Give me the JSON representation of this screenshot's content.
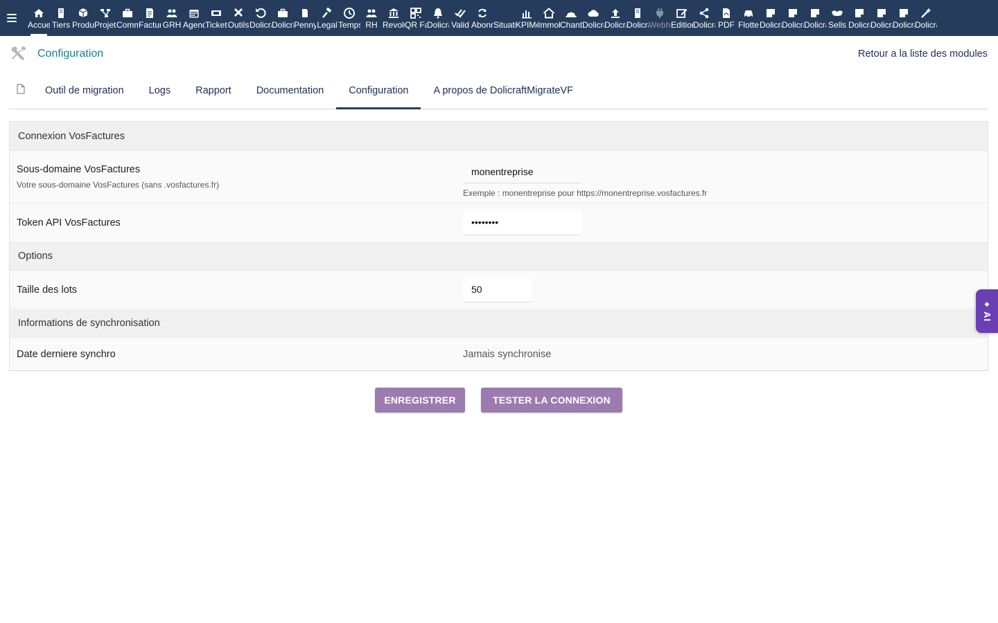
{
  "topbar": {
    "menu_items": [
      {
        "label": "Accueil",
        "icon": "home-icon"
      },
      {
        "label": "Tiers",
        "icon": "building-icon"
      },
      {
        "label": "Produits",
        "icon": "cube-icon"
      },
      {
        "label": "Projets",
        "icon": "sitemap-icon"
      },
      {
        "label": "Commerce",
        "icon": "briefcase-icon"
      },
      {
        "label": "Facturation",
        "icon": "invoice-icon"
      },
      {
        "label": "GRH",
        "icon": "users-icon"
      },
      {
        "label": "Agenda",
        "icon": "calendar-icon"
      },
      {
        "label": "Tickets",
        "icon": "ticket-icon"
      },
      {
        "label": "Outils",
        "icon": "tools-icon"
      },
      {
        "label": "Dolicraft",
        "icon": "undo-icon"
      },
      {
        "label": "Dolicraft",
        "icon": "briefcase-icon"
      },
      {
        "label": "Penny",
        "icon": "file-icon"
      },
      {
        "label": "Legal",
        "icon": "gavel-icon"
      },
      {
        "label": "Temps",
        "icon": "clock-icon"
      },
      {
        "label": "RH",
        "icon": "users-icon"
      },
      {
        "label": "Revolut",
        "icon": "bank-icon"
      },
      {
        "label": "QR Factures",
        "icon": "qrcode-icon"
      },
      {
        "label": "Dolicraft",
        "icon": "bell-icon"
      },
      {
        "label": "Valid",
        "icon": "check-double-icon"
      },
      {
        "label": "Abonnements",
        "icon": "refresh-icon"
      },
      {
        "label": "Situation",
        "icon": "blank-icon"
      },
      {
        "label": "KPIMeter",
        "icon": "chart-bar-icon"
      },
      {
        "label": "Immobilier",
        "icon": "house-icon"
      },
      {
        "label": "Chantier",
        "icon": "hard-hat-icon"
      },
      {
        "label": "Dolicraft",
        "icon": "cloud-icon"
      },
      {
        "label": "Dolicraft",
        "icon": "upload-icon"
      },
      {
        "label": "Dolicraft",
        "icon": "building-icon"
      },
      {
        "label": "Webhooks",
        "icon": "plug-icon"
      },
      {
        "label": "Edition",
        "icon": "edit-icon"
      },
      {
        "label": "Dolicraft",
        "icon": "share-icon"
      },
      {
        "label": "PDF",
        "icon": "pdf-icon"
      },
      {
        "label": "Flotte",
        "icon": "car-icon"
      },
      {
        "label": "Dolicraft",
        "icon": "note-icon"
      },
      {
        "label": "Dolicraft",
        "icon": "note-icon"
      },
      {
        "label": "Dolicraft",
        "icon": "note-icon"
      },
      {
        "label": "Sells",
        "icon": "handshake-icon"
      },
      {
        "label": "Dolicraft",
        "icon": "note-icon"
      },
      {
        "label": "Dolicraft",
        "icon": "note-icon"
      },
      {
        "label": "Dolicraft",
        "icon": "note-icon"
      },
      {
        "label": "Dolicraft",
        "icon": "magic-icon"
      }
    ]
  },
  "header": {
    "title": "Configuration",
    "back_link": "Retour a la liste des modules"
  },
  "tabs": [
    {
      "label": "Outil de migration"
    },
    {
      "label": "Logs"
    },
    {
      "label": "Rapport"
    },
    {
      "label": "Documentation"
    },
    {
      "label": "Configuration",
      "active": true
    },
    {
      "label": "A propos de DolicraftMigrateVF"
    }
  ],
  "settings": {
    "connection_section": "Connexion VosFactures",
    "subdomain": {
      "label": "Sous-domaine VosFactures",
      "help": "Votre sous-domaine VosFactures (sans .vosfactures.fr)",
      "value": "monentreprise",
      "example": "Exemple : monentreprise pour https://monentreprise.vosfactures.fr"
    },
    "token": {
      "label": "Token API VosFactures",
      "value": "••••••••"
    },
    "options_section": "Options",
    "batch": {
      "label": "Taille des lots",
      "value": "50"
    },
    "sync_section": "Informations de synchronisation",
    "last_sync": {
      "label": "Date derniere synchro",
      "value": "Jamais synchronise"
    }
  },
  "actions": {
    "save_label": "ENREGISTRER",
    "test_label": "TESTER LA CONNEXION"
  },
  "ai_tab": {
    "label": "AI"
  },
  "colors": {
    "topbar_bg": "#263c5c",
    "accent_button": "#9c7cb0",
    "title_color": "#1e7c8a",
    "ai_tab_bg": "#6a3fb4"
  }
}
